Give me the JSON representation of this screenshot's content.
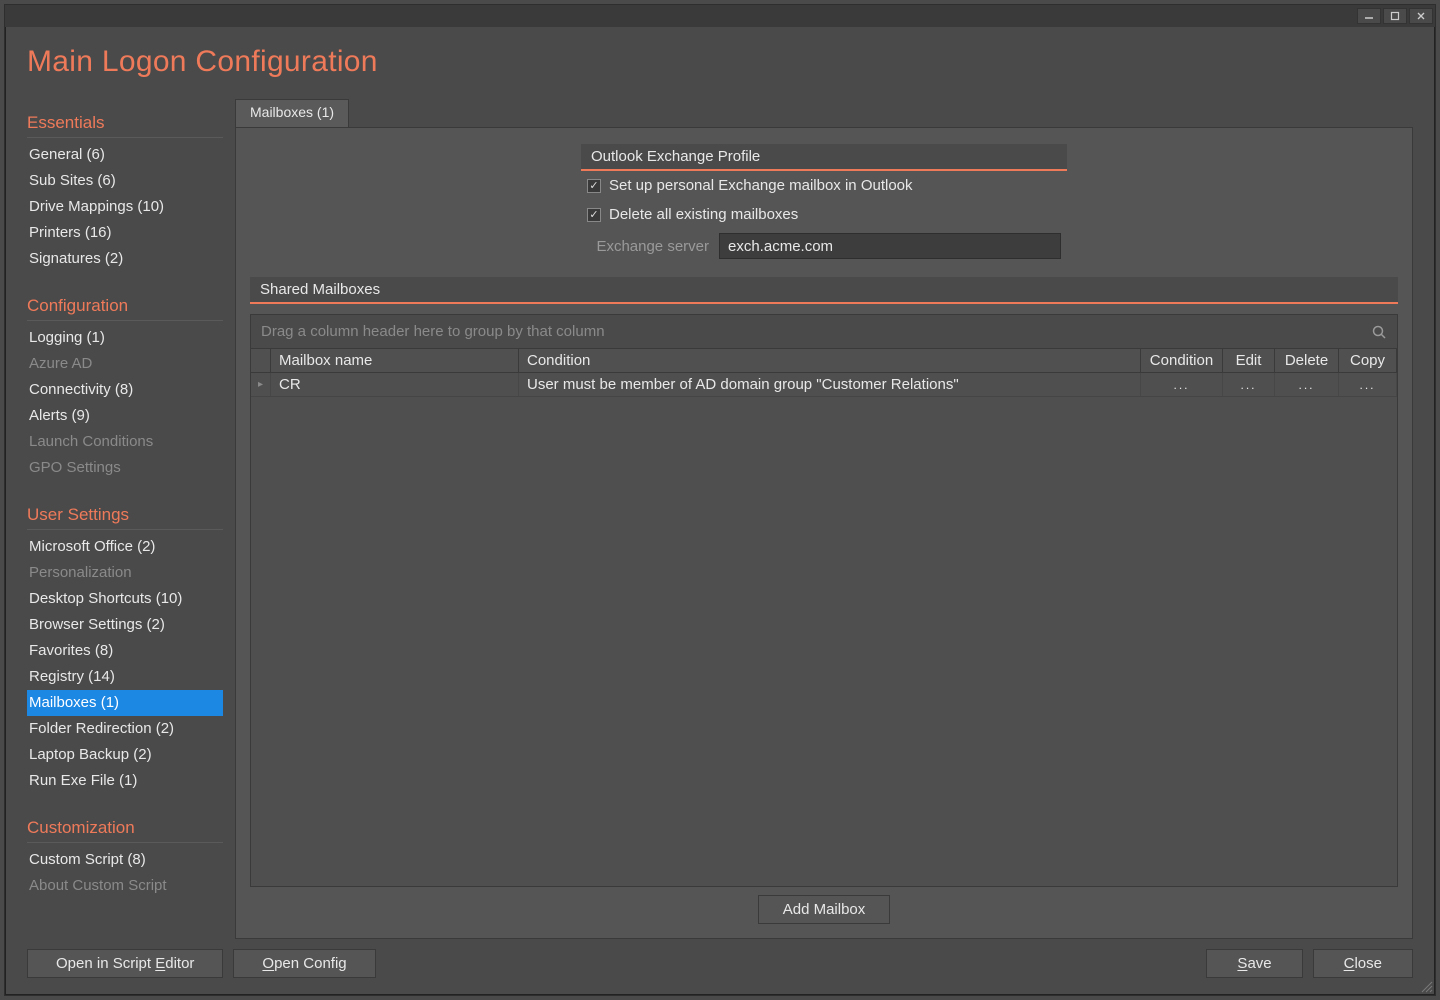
{
  "title": "Main Logon Configuration",
  "sidebar": {
    "sections": [
      {
        "label": "Essentials",
        "items": [
          {
            "label": "General (6)"
          },
          {
            "label": "Sub Sites (6)"
          },
          {
            "label": "Drive Mappings (10)"
          },
          {
            "label": "Printers (16)"
          },
          {
            "label": "Signatures (2)"
          }
        ]
      },
      {
        "label": "Configuration",
        "items": [
          {
            "label": "Logging (1)"
          },
          {
            "label": "Azure AD",
            "disabled": true
          },
          {
            "label": "Connectivity (8)"
          },
          {
            "label": "Alerts (9)"
          },
          {
            "label": "Launch Conditions",
            "disabled": true
          },
          {
            "label": "GPO Settings",
            "disabled": true
          }
        ]
      },
      {
        "label": "User Settings",
        "items": [
          {
            "label": "Microsoft Office (2)"
          },
          {
            "label": "Personalization",
            "disabled": true
          },
          {
            "label": "Desktop Shortcuts (10)"
          },
          {
            "label": "Browser Settings (2)"
          },
          {
            "label": "Favorites (8)"
          },
          {
            "label": "Registry (14)"
          },
          {
            "label": "Mailboxes (1)",
            "selected": true
          },
          {
            "label": "Folder Redirection (2)"
          },
          {
            "label": "Laptop Backup (2)"
          },
          {
            "label": "Run Exe File (1)"
          }
        ]
      },
      {
        "label": "Customization",
        "items": [
          {
            "label": "Custom Script (8)"
          },
          {
            "label": "About Custom Script",
            "disabled": true
          }
        ]
      }
    ]
  },
  "tab_label": "Mailboxes (1)",
  "outlook_group": {
    "header": "Outlook Exchange Profile",
    "chk1_label": "Set up personal Exchange mailbox in Outlook",
    "chk1_checked": true,
    "chk2_label": "Delete all existing mailboxes",
    "chk2_checked": true,
    "server_label": "Exchange server",
    "server_value": "exch.acme.com"
  },
  "shared_group": {
    "header": "Shared Mailboxes",
    "group_hint": "Drag a column header here to group by that column",
    "columns": {
      "name": "Mailbox name",
      "condition_text": "Condition",
      "condition_btn": "Condition",
      "edit": "Edit",
      "delete": "Delete",
      "copy": "Copy"
    },
    "rows": [
      {
        "name": "CR",
        "condition": "User must be member of AD domain group \"Customer Relations\""
      }
    ],
    "ellipsis": "..."
  },
  "buttons": {
    "add_mailbox": "Add Mailbox",
    "open_editor_pre": "Open in Script ",
    "open_editor_mn": "E",
    "open_editor_post": "ditor",
    "open_config_mn": "O",
    "open_config_post": "pen Config",
    "save_mn": "S",
    "save_post": "ave",
    "close_mn": "C",
    "close_post": "lose"
  }
}
